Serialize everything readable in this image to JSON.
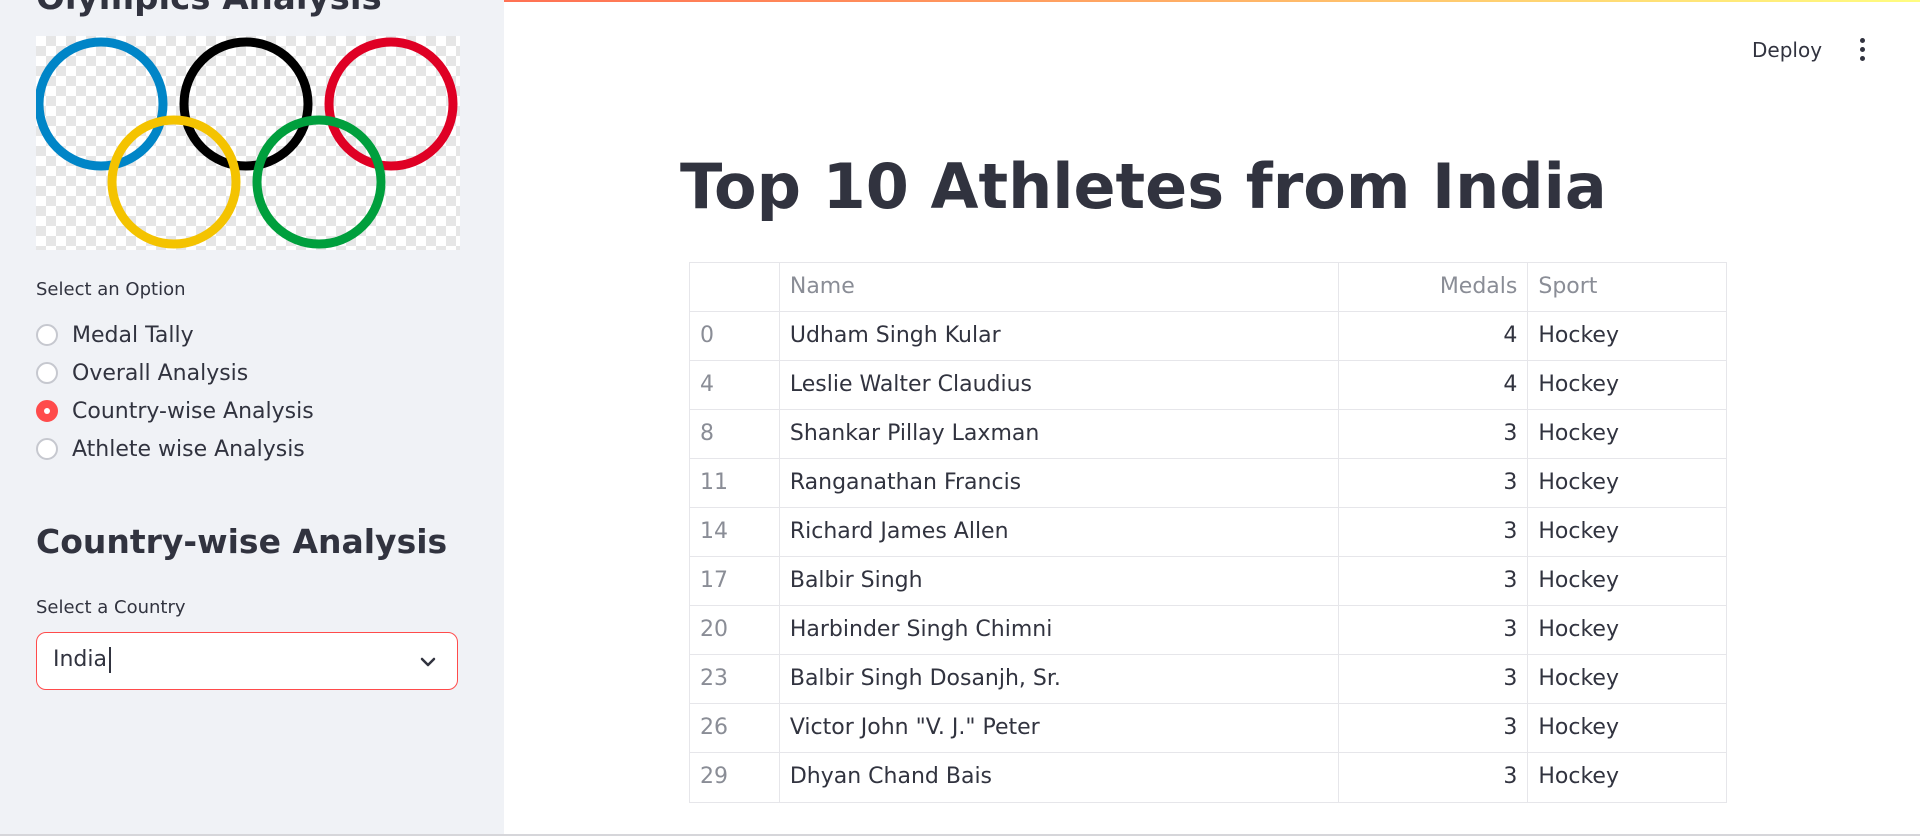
{
  "sidebar": {
    "title": "Olympics Analysis",
    "option_label": "Select an Option",
    "options": [
      {
        "label": "Medal Tally",
        "selected": false
      },
      {
        "label": "Overall Analysis",
        "selected": false
      },
      {
        "label": "Country-wise Analysis",
        "selected": true
      },
      {
        "label": "Athlete wise Analysis",
        "selected": false
      }
    ],
    "section_title": "Country-wise Analysis",
    "country_label": "Select a Country",
    "country_value": "India"
  },
  "header": {
    "deploy_label": "Deploy",
    "menu_icon": "kebab-menu-icon"
  },
  "main": {
    "title": "Top 10 Athletes from India",
    "table": {
      "columns": [
        "",
        "Name",
        "Medals",
        "Sport"
      ],
      "rows": [
        {
          "index": "0",
          "name": "Udham Singh Kular",
          "medals": "4",
          "sport": "Hockey"
        },
        {
          "index": "4",
          "name": "Leslie Walter Claudius",
          "medals": "4",
          "sport": "Hockey"
        },
        {
          "index": "8",
          "name": "Shankar Pillay Laxman",
          "medals": "3",
          "sport": "Hockey"
        },
        {
          "index": "11",
          "name": "Ranganathan Francis",
          "medals": "3",
          "sport": "Hockey"
        },
        {
          "index": "14",
          "name": "Richard James Allen",
          "medals": "3",
          "sport": "Hockey"
        },
        {
          "index": "17",
          "name": "Balbir Singh",
          "medals": "3",
          "sport": "Hockey"
        },
        {
          "index": "20",
          "name": "Harbinder Singh Chimni",
          "medals": "3",
          "sport": "Hockey"
        },
        {
          "index": "23",
          "name": "Balbir Singh Dosanjh, Sr.",
          "medals": "3",
          "sport": "Hockey"
        },
        {
          "index": "26",
          "name": "Victor John \"V. J.\" Peter",
          "medals": "3",
          "sport": "Hockey"
        },
        {
          "index": "29",
          "name": "Dhyan Chand Bais",
          "medals": "3",
          "sport": "Hockey"
        }
      ]
    }
  },
  "colors": {
    "accent": "#ff4b4b",
    "sidebar_bg": "#f0f2f6",
    "text": "#31333f",
    "ring_blue": "#0085c7",
    "ring_black": "#000000",
    "ring_red": "#df0024",
    "ring_yellow": "#f4c300",
    "ring_green": "#009f3d"
  }
}
